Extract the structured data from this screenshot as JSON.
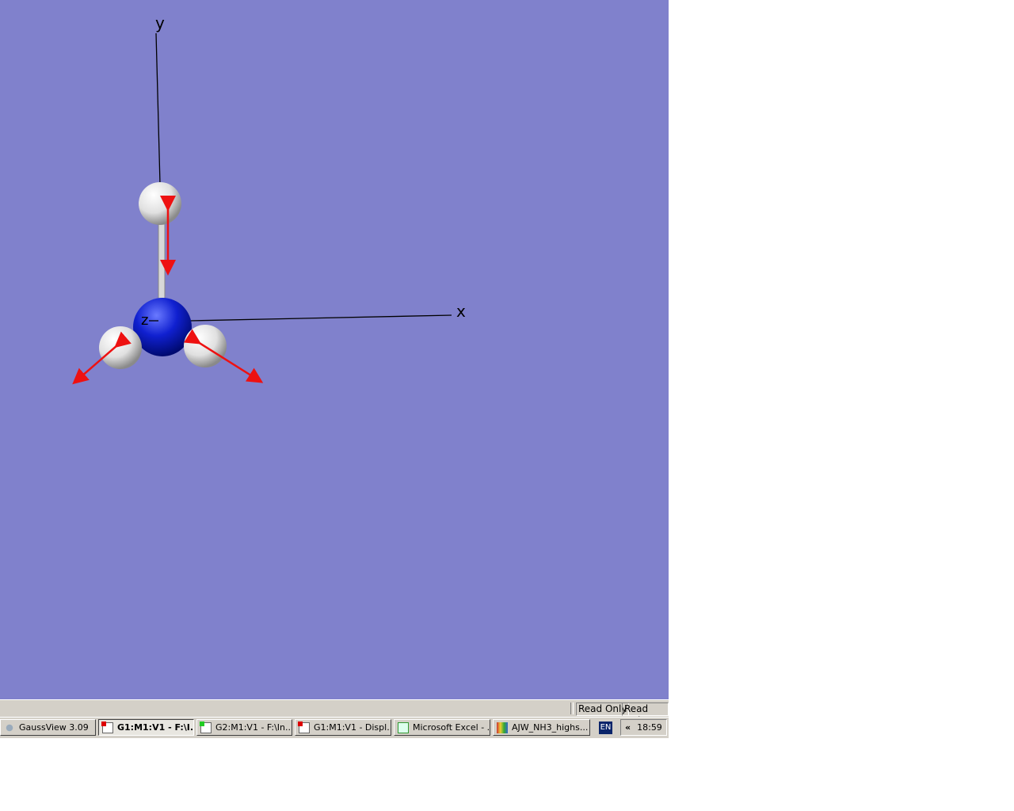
{
  "viewer": {
    "axis_labels": {
      "x": "x",
      "y": "y",
      "z": "z"
    },
    "colors": {
      "background": "#8081cc",
      "nitrogen": "#1020d0",
      "hydrogen": "#f0f0f0",
      "vector": "#ee1111"
    }
  },
  "status_bar": {
    "panes": [
      "Read Only",
      "Read Only"
    ]
  },
  "taskbar": {
    "tasks": [
      {
        "label": "GaussView 3.09",
        "icon": "gaussview-icon",
        "active": false
      },
      {
        "label": "G1:M1:V1 - F:\\I...",
        "icon": "molecule-window-icon",
        "active": true
      },
      {
        "label": "G2:M1:V1 - F:\\In...",
        "icon": "molecule-window-icon",
        "active": false
      },
      {
        "label": "G1:M1:V1 - Displ...",
        "icon": "molecule-window-icon",
        "active": false
      },
      {
        "label": "Microsoft Excel - ...",
        "icon": "excel-icon",
        "active": false
      },
      {
        "label": "AJW_NH3_highs...",
        "icon": "paint-icon",
        "active": false
      }
    ],
    "language": "EN",
    "tray_expand": "«",
    "clock": "18:59"
  }
}
